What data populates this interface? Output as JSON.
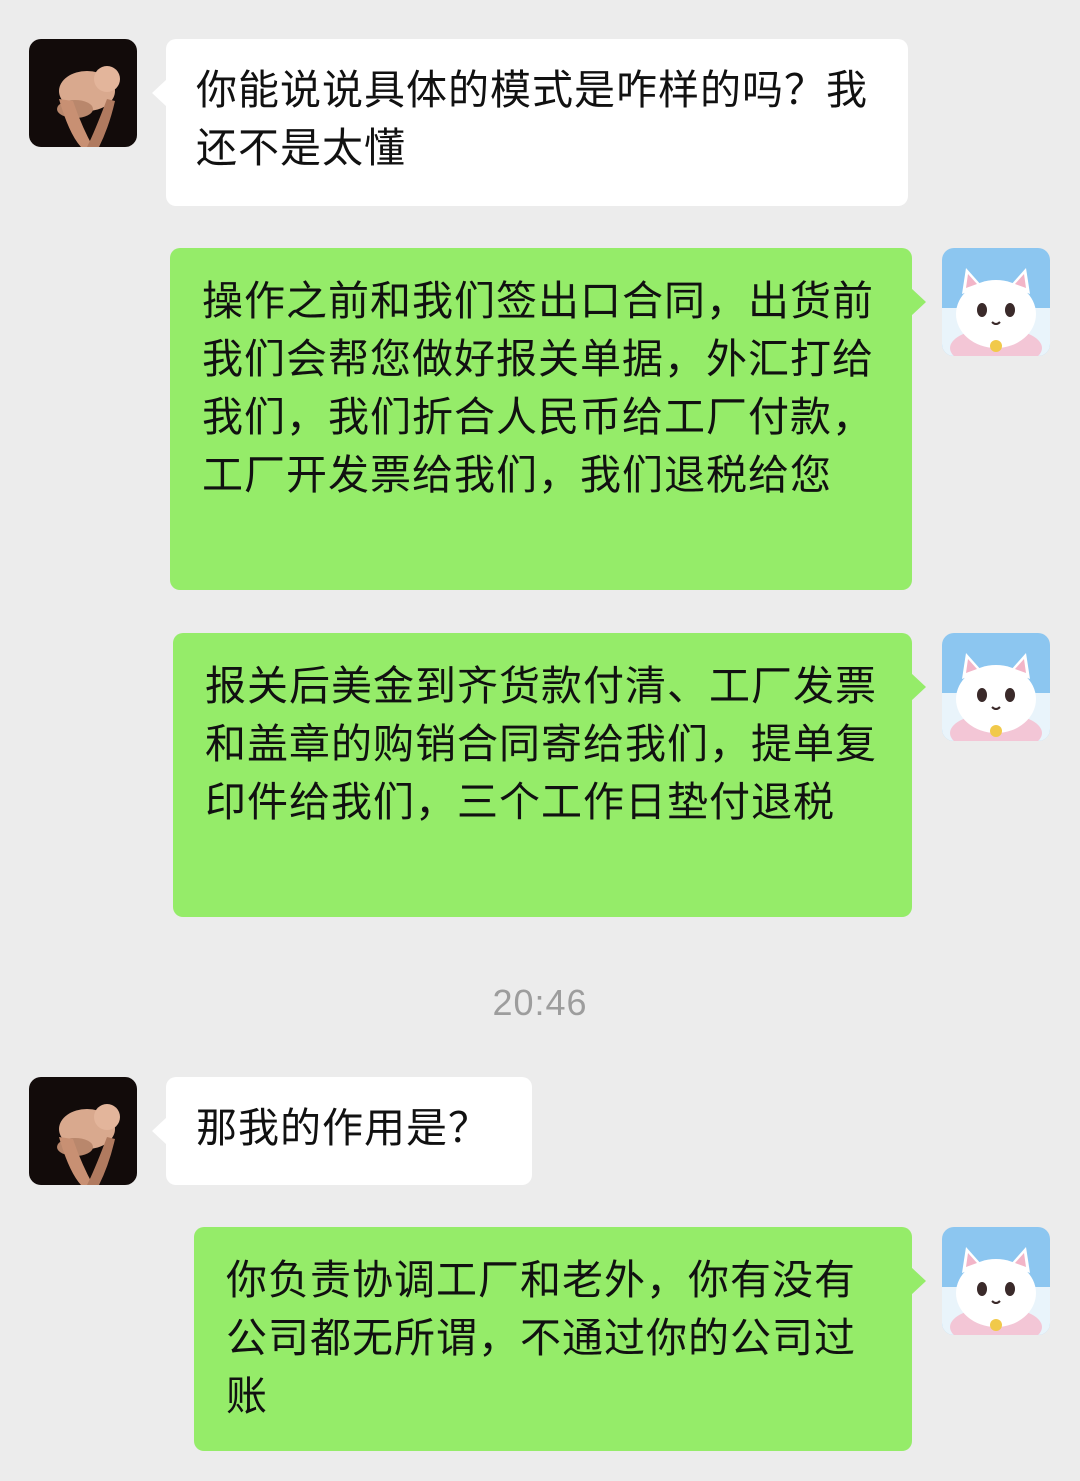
{
  "messages": [
    {
      "side": "in",
      "avatar": "baby-avatar",
      "text": "你能说说具体的模式是咋样的吗？我还不是太懂"
    },
    {
      "side": "out",
      "avatar": "cat-avatar",
      "text": "操作之前和我们签出口合同，出货前我们会帮您做好报关单据，外汇打给我们，我们折合人民币给工厂付款，工厂开发票给我们，我们退税给您"
    },
    {
      "side": "out",
      "avatar": "cat-avatar",
      "text": "报关后美金到齐货款付清、工厂发票和盖章的购销合同寄给我们，提单复印件给我们，三个工作日垫付退税"
    },
    {
      "side": "in",
      "avatar": "baby-avatar",
      "text": "那我的作用是？"
    },
    {
      "side": "out",
      "avatar": "cat-avatar",
      "text": "你负责协调工厂和老外，你有没有公司都无所谓，不通过你的公司过账"
    }
  ],
  "timestamp": "20:46",
  "colors": {
    "background": "#ececec",
    "incoming_bubble": "#ffffff",
    "outgoing_bubble": "#95ec69",
    "timestamp_text": "#9d9d9d"
  }
}
